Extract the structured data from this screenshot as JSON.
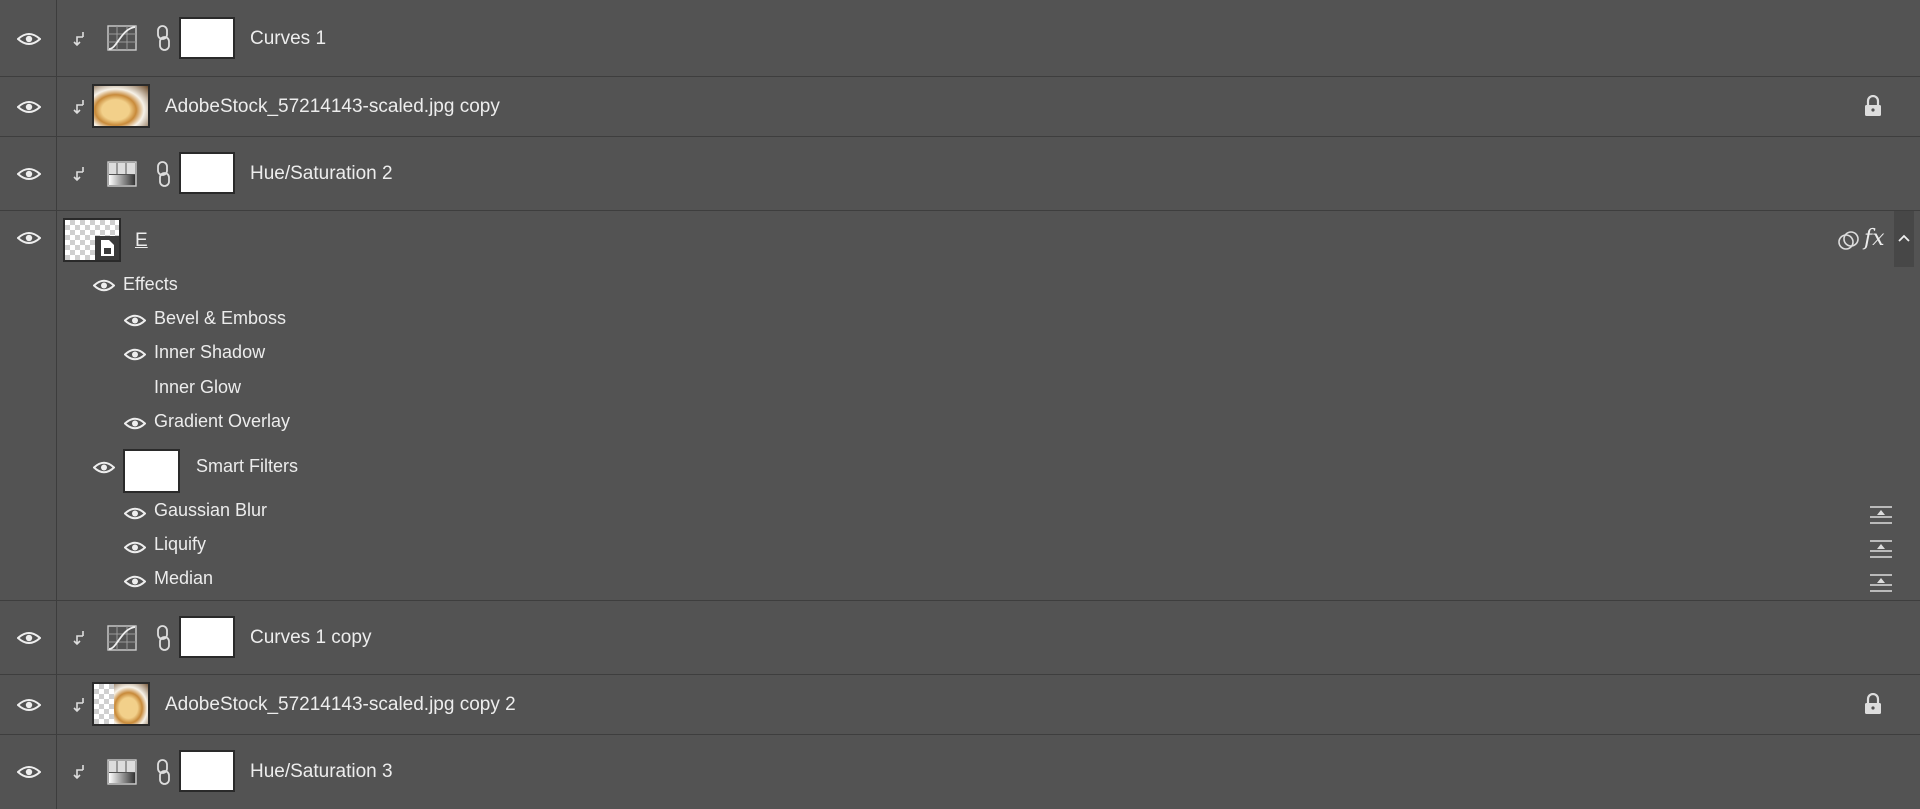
{
  "layers": {
    "curves1": {
      "name": "Curves 1"
    },
    "adobe_copy": {
      "name": "AdobeStock_57214143-scaled.jpg copy"
    },
    "hue2": {
      "name": "Hue/Saturation 2"
    },
    "e_layer": {
      "name": "E",
      "effects_label": "Effects",
      "effects": [
        "Bevel & Emboss",
        "Inner Shadow",
        "Inner Glow",
        "Gradient Overlay"
      ],
      "smart_filters_label": "Smart Filters",
      "filters": [
        "Gaussian Blur",
        "Liquify",
        "Median"
      ],
      "fx_label": "fx"
    },
    "curves1_copy": {
      "name": "Curves 1 copy"
    },
    "adobe_copy2": {
      "name": "AdobeStock_57214143-scaled.jpg copy 2"
    },
    "hue3": {
      "name": "Hue/Saturation 3"
    }
  },
  "colors": {
    "panel_bg": "#535353",
    "divider": "#3e3e3e",
    "text": "#ececec"
  }
}
